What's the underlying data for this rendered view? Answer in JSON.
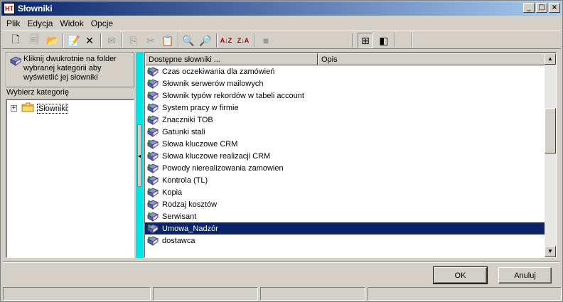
{
  "window": {
    "title": "Słowniki",
    "app_icon_text": "HT",
    "minimize_label": "_",
    "maximize_label": "□",
    "close_label": "×"
  },
  "menu": [
    "Plik",
    "Edycja",
    "Widok",
    "Opcje"
  ],
  "toolbar": {
    "buttons": [
      {
        "name": "new-document-icon",
        "glyph": "🗋",
        "enabled": true
      },
      {
        "name": "properties-icon",
        "glyph": "🗐",
        "enabled": false
      },
      {
        "name": "edit-folder-icon",
        "glyph": "📂",
        "enabled": true
      },
      {
        "name": "edit-icon",
        "glyph": "📝",
        "enabled": true
      },
      {
        "name": "delete-icon",
        "glyph": "✕",
        "enabled": true
      },
      {
        "name": "send-icon",
        "glyph": "✉",
        "enabled": false
      },
      {
        "name": "copy-icon",
        "glyph": "⎘",
        "enabled": false
      },
      {
        "name": "cut-icon",
        "glyph": "✂",
        "enabled": false
      },
      {
        "name": "paste-icon",
        "glyph": "📋",
        "enabled": false
      },
      {
        "name": "find-icon",
        "glyph": "🔍",
        "enabled": true
      },
      {
        "name": "find-next-icon",
        "glyph": "🔎",
        "enabled": true
      },
      {
        "name": "sort-ascending-icon",
        "glyph": "A↓Z",
        "enabled": true
      },
      {
        "name": "sort-descending-icon",
        "glyph": "Z↓A",
        "enabled": true
      },
      {
        "name": "filter-icon",
        "glyph": "■",
        "enabled": false
      },
      {
        "name": "tree-view-icon",
        "glyph": "⊞",
        "enabled": true
      },
      {
        "name": "toggle-pane-icon",
        "glyph": "◧",
        "enabled": true
      }
    ]
  },
  "hint": {
    "text": "Kliknij dwukrotnie na folder wybranej kategorii aby wyświetlić jej słowniki"
  },
  "category": {
    "label": "Wybierz kategorię",
    "tree": [
      {
        "label": "Słowniki",
        "expander": "+"
      }
    ]
  },
  "splitter": {
    "collapse_glyph": "◂"
  },
  "list": {
    "columns": [
      "Dostępne słowniki ...",
      "Opis"
    ],
    "rows": [
      {
        "label": "Czas oczekiwania dla zamówień",
        "selected": false
      },
      {
        "label": "Słownik serwerów mailowych",
        "selected": false
      },
      {
        "label": "Słownik typów rekordów w tabeli account",
        "selected": false
      },
      {
        "label": "System pracy w firmie",
        "selected": false
      },
      {
        "label": "Znaczniki TOB",
        "selected": false
      },
      {
        "label": "Gatunki stali",
        "selected": false
      },
      {
        "label": "Słowa kluczowe CRM",
        "selected": false
      },
      {
        "label": "Słowa kluczowe realizacji CRM",
        "selected": false
      },
      {
        "label": "Powody nierealizowania zamowien",
        "selected": false
      },
      {
        "label": "Kontrola (TL)",
        "selected": false
      },
      {
        "label": "Kopia",
        "selected": false
      },
      {
        "label": "Rodzaj kosztów",
        "selected": false
      },
      {
        "label": "Serwisant",
        "selected": false
      },
      {
        "label": "Umowa_Nadzór",
        "selected": true
      },
      {
        "label": "dostawca",
        "selected": false
      }
    ],
    "scroll_up": "▲",
    "scroll_down": "▼"
  },
  "buttons": {
    "ok": "OK",
    "cancel": "Anuluj"
  },
  "colors": {
    "accent": "#0a246a",
    "splitter": "#00e5e5",
    "face": "#d4d0c8"
  }
}
